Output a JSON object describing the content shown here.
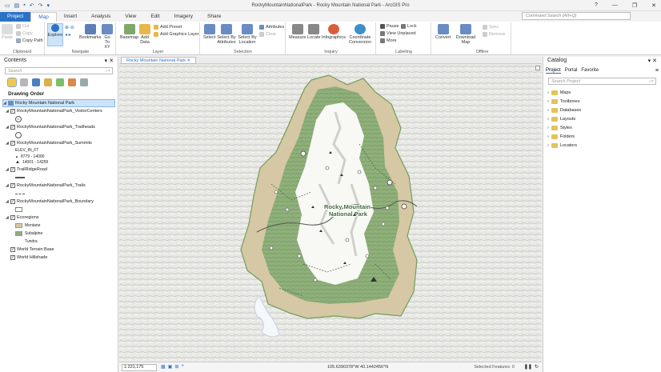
{
  "window": {
    "title": "RockyMountainNationalPark - Rocky Mountain National Park - ArcGIS Pro",
    "controls": [
      "?",
      "—",
      "❐",
      "✕"
    ]
  },
  "tabs": [
    "Project",
    "Map",
    "Insert",
    "Analysis",
    "View",
    "Edit",
    "Imagery",
    "Share"
  ],
  "active_tab": "Map",
  "command_search": {
    "placeholder": "Command Search (Alt+Q)"
  },
  "ribbon": {
    "clipboard": {
      "label": "Clipboard",
      "paste": "Paste",
      "cut": "Cut",
      "copy": "Copy",
      "copy_path": "Copy Path"
    },
    "navigate": {
      "label": "Navigate",
      "explore": "Explore",
      "bookmarks": "Bookmarks",
      "goto": "Go To XY"
    },
    "layer": {
      "label": "Layer",
      "basemap": "Basemap",
      "add_data": "Add Data",
      "add_preset": "Add Preset",
      "add_graphics": "Add Graphics Layer"
    },
    "selection": {
      "label": "Selection",
      "select": "Select",
      "by_attr": "Select By Attributes",
      "by_loc": "Select By Location",
      "attributes": "Attributes",
      "clear": "Clear"
    },
    "inquiry": {
      "label": "Inquiry",
      "measure": "Measure",
      "locate": "Locate",
      "infographics": "Infographics",
      "coord": "Coordinate Conversion"
    },
    "labeling": {
      "label": "Labeling",
      "pause": "Pause",
      "lock": "Lock",
      "view_unplaced": "View Unplaced",
      "more": "More",
      "convert": "Convert"
    },
    "offline": {
      "label": "Offline",
      "download": "Download Map",
      "sync": "Sync",
      "remove": "Remove"
    }
  },
  "contents": {
    "title": "Contents",
    "search_placeholder": "Search",
    "drawing_order": "Drawing Order",
    "map_name": "Rocky Mountain National Park",
    "layers": {
      "visitor": "RockyMountainNationalPark_VisitorCenters",
      "trailheads": "RockyMountainNationalPark_Trailheads",
      "summits": "RockyMountainNationalPark_Summits",
      "elev_field": "ELEV_IN_FT",
      "elev1": "8779 - 14000",
      "elev2": "14001 - 14259",
      "ridge": "TrailRidgeRoad",
      "trails": "RockyMountainNationalPark_Trails",
      "boundary": "RockyMountainNationalPark_Boundary",
      "ecoregions": "Ecoregions",
      "montane": "Montane",
      "subalpine": "Subalpine",
      "tundra": "Tundra",
      "terrain": "World Terrain Base",
      "hillshade": "World Hillshade"
    }
  },
  "map_view": {
    "tab": "Rocky Mountain National Park",
    "park_label_1": "Rocky Mountain",
    "park_label_2": "National Park",
    "scale": "1:221,175",
    "coords": "105.6390378°W 40.1442456°N",
    "selected": "Selected Features: 0"
  },
  "catalog": {
    "title": "Catalog",
    "tabs": [
      "Project",
      "Portal",
      "Favorite"
    ],
    "search_placeholder": "Search Project",
    "items": [
      "Maps",
      "Toolboxes",
      "Databases",
      "Layouts",
      "Styles",
      "Folders",
      "Locators"
    ]
  },
  "colors": {
    "accent": "#2a72c6",
    "montane": "#d6c8a4",
    "subalpine": "#8fb07a",
    "tundra": "#ffffff",
    "trail": "#3f8a4a"
  }
}
